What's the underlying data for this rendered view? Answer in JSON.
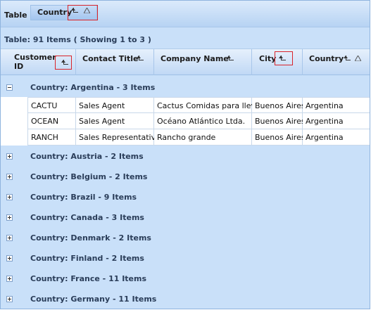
{
  "group_panel": {
    "label": "Table",
    "chip_label": "Country"
  },
  "caption": "Table: 91 Items ( Showing 1 to 3 )",
  "columns": [
    {
      "label": "Customer ID"
    },
    {
      "label": "Contact Title"
    },
    {
      "label": "Company Name"
    },
    {
      "label": "City"
    },
    {
      "label": "Country"
    }
  ],
  "groups": [
    {
      "label": "Country: Argentina - 3 Items",
      "expanded": true,
      "rows": [
        [
          "CACTU",
          "Sales Agent",
          "Cactus Comidas para llevar",
          "Buenos Aires",
          "Argentina"
        ],
        [
          "OCEAN",
          "Sales Agent",
          "Océano Atlántico Ltda.",
          "Buenos Aires",
          "Argentina"
        ],
        [
          "RANCH",
          "Sales Representative",
          "Rancho grande",
          "Buenos Aires",
          "Argentina"
        ]
      ]
    },
    {
      "label": "Country: Austria - 2 Items",
      "expanded": false
    },
    {
      "label": "Country: Belgium - 2 Items",
      "expanded": false
    },
    {
      "label": "Country: Brazil - 9 Items",
      "expanded": false
    },
    {
      "label": "Country: Canada - 3 Items",
      "expanded": false
    },
    {
      "label": "Country: Denmark - 2 Items",
      "expanded": false
    },
    {
      "label": "Country: Finland - 2 Items",
      "expanded": false
    },
    {
      "label": "Country: France - 11 Items",
      "expanded": false
    },
    {
      "label": "Country: Germany - 11 Items",
      "expanded": false
    }
  ],
  "icons": {
    "group_icon": "group-by-icon",
    "sort_icon": "sort-ascending-icon",
    "toggle_expanded": "collapse-icon",
    "toggle_collapsed": "expand-icon"
  },
  "colors": {
    "background": "#c9e0f9",
    "highlight": "#d9242a"
  }
}
